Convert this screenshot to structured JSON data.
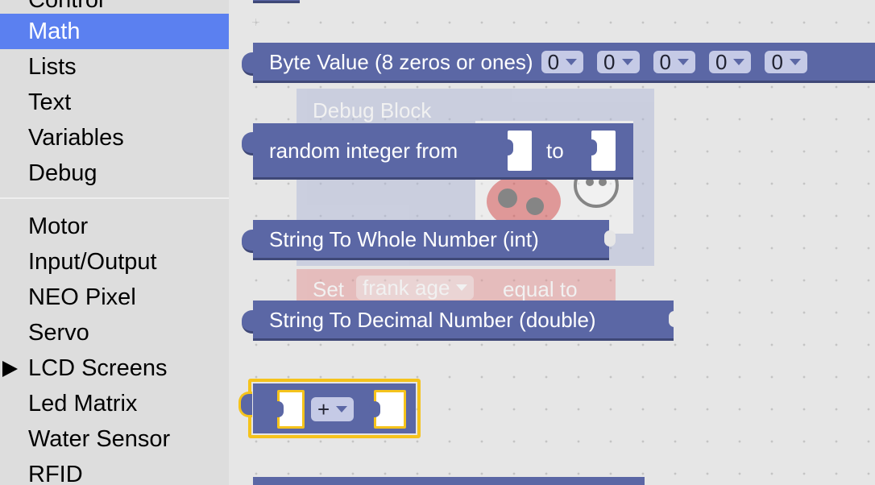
{
  "sidebar": {
    "categories": [
      {
        "label": "Control"
      },
      {
        "label": "Math",
        "selected": true
      },
      {
        "label": "Lists"
      },
      {
        "label": "Text"
      },
      {
        "label": "Variables"
      },
      {
        "label": "Debug"
      },
      {
        "label": "Motor"
      },
      {
        "label": "Input/Output"
      },
      {
        "label": "NEO Pixel"
      },
      {
        "label": "Servo"
      },
      {
        "label": "LCD Screens",
        "expandable": true
      },
      {
        "label": "Led Matrix"
      },
      {
        "label": "Water Sensor"
      },
      {
        "label": "RFID"
      }
    ]
  },
  "workspace": {
    "byte_block": {
      "label": "Byte Value (8 zeros or ones)",
      "bits": [
        "0",
        "0",
        "0",
        "0",
        "0"
      ]
    },
    "debug_ghost": {
      "label": "Debug Block"
    },
    "random_block": {
      "label": "random integer from",
      "to_label": "to"
    },
    "string_int_block": {
      "label": "String To Whole Number (int)"
    },
    "set_ghost": {
      "set_label": "Set",
      "variable": "frank age",
      "equal_label": "equal to"
    },
    "string_double_block": {
      "label": "String To Decimal Number (double)"
    },
    "arith_block": {
      "operator": "+"
    },
    "colors": {
      "block": "#5b67a5",
      "block_shadow": "#3f4877",
      "selected_outline": "#f5c31c",
      "sidebar_selected": "#5b80f0",
      "ghost_debug": "#9aa4c8",
      "ghost_set": "#e06a6a"
    }
  }
}
